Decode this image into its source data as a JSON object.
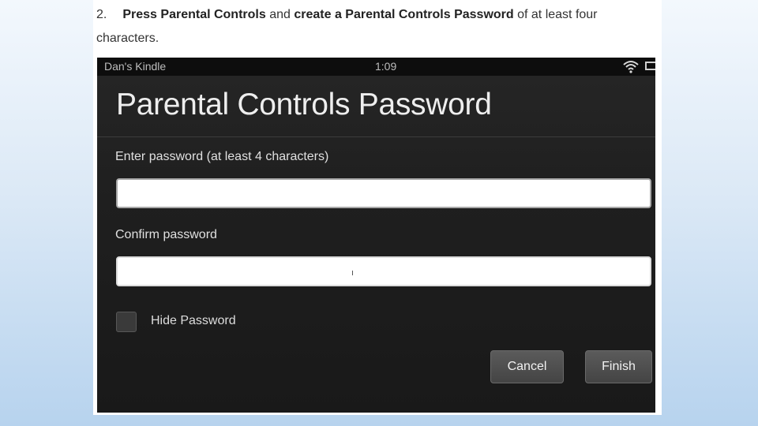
{
  "instruction": {
    "number": "2.",
    "parts": [
      {
        "text": "Press ",
        "bold": true
      },
      {
        "text": "Parental Controls",
        "bold": true
      },
      {
        "text": " and ",
        "bold": false
      },
      {
        "text": "create a Parental Controls Password",
        "bold": true
      },
      {
        "text": " of at least four characters.",
        "bold": false
      }
    ]
  },
  "status_bar": {
    "device_name": "Dan's Kindle",
    "time": "1:09",
    "wifi_icon": "wifi-icon",
    "battery_icon": "battery-icon"
  },
  "screen": {
    "title": "Parental Controls Password",
    "password_label": "Enter password (at least 4 characters)",
    "password_value": "",
    "confirm_label": "Confirm password",
    "confirm_value": "",
    "hide_password_label": "Hide Password",
    "hide_password_checked": false,
    "cancel_label": "Cancel",
    "finish_label": "Finish"
  },
  "colors": {
    "screen_bg": "#1f1f1f",
    "status_bar_bg": "#0d0d0d",
    "button_bg": "#4f4f4f"
  }
}
